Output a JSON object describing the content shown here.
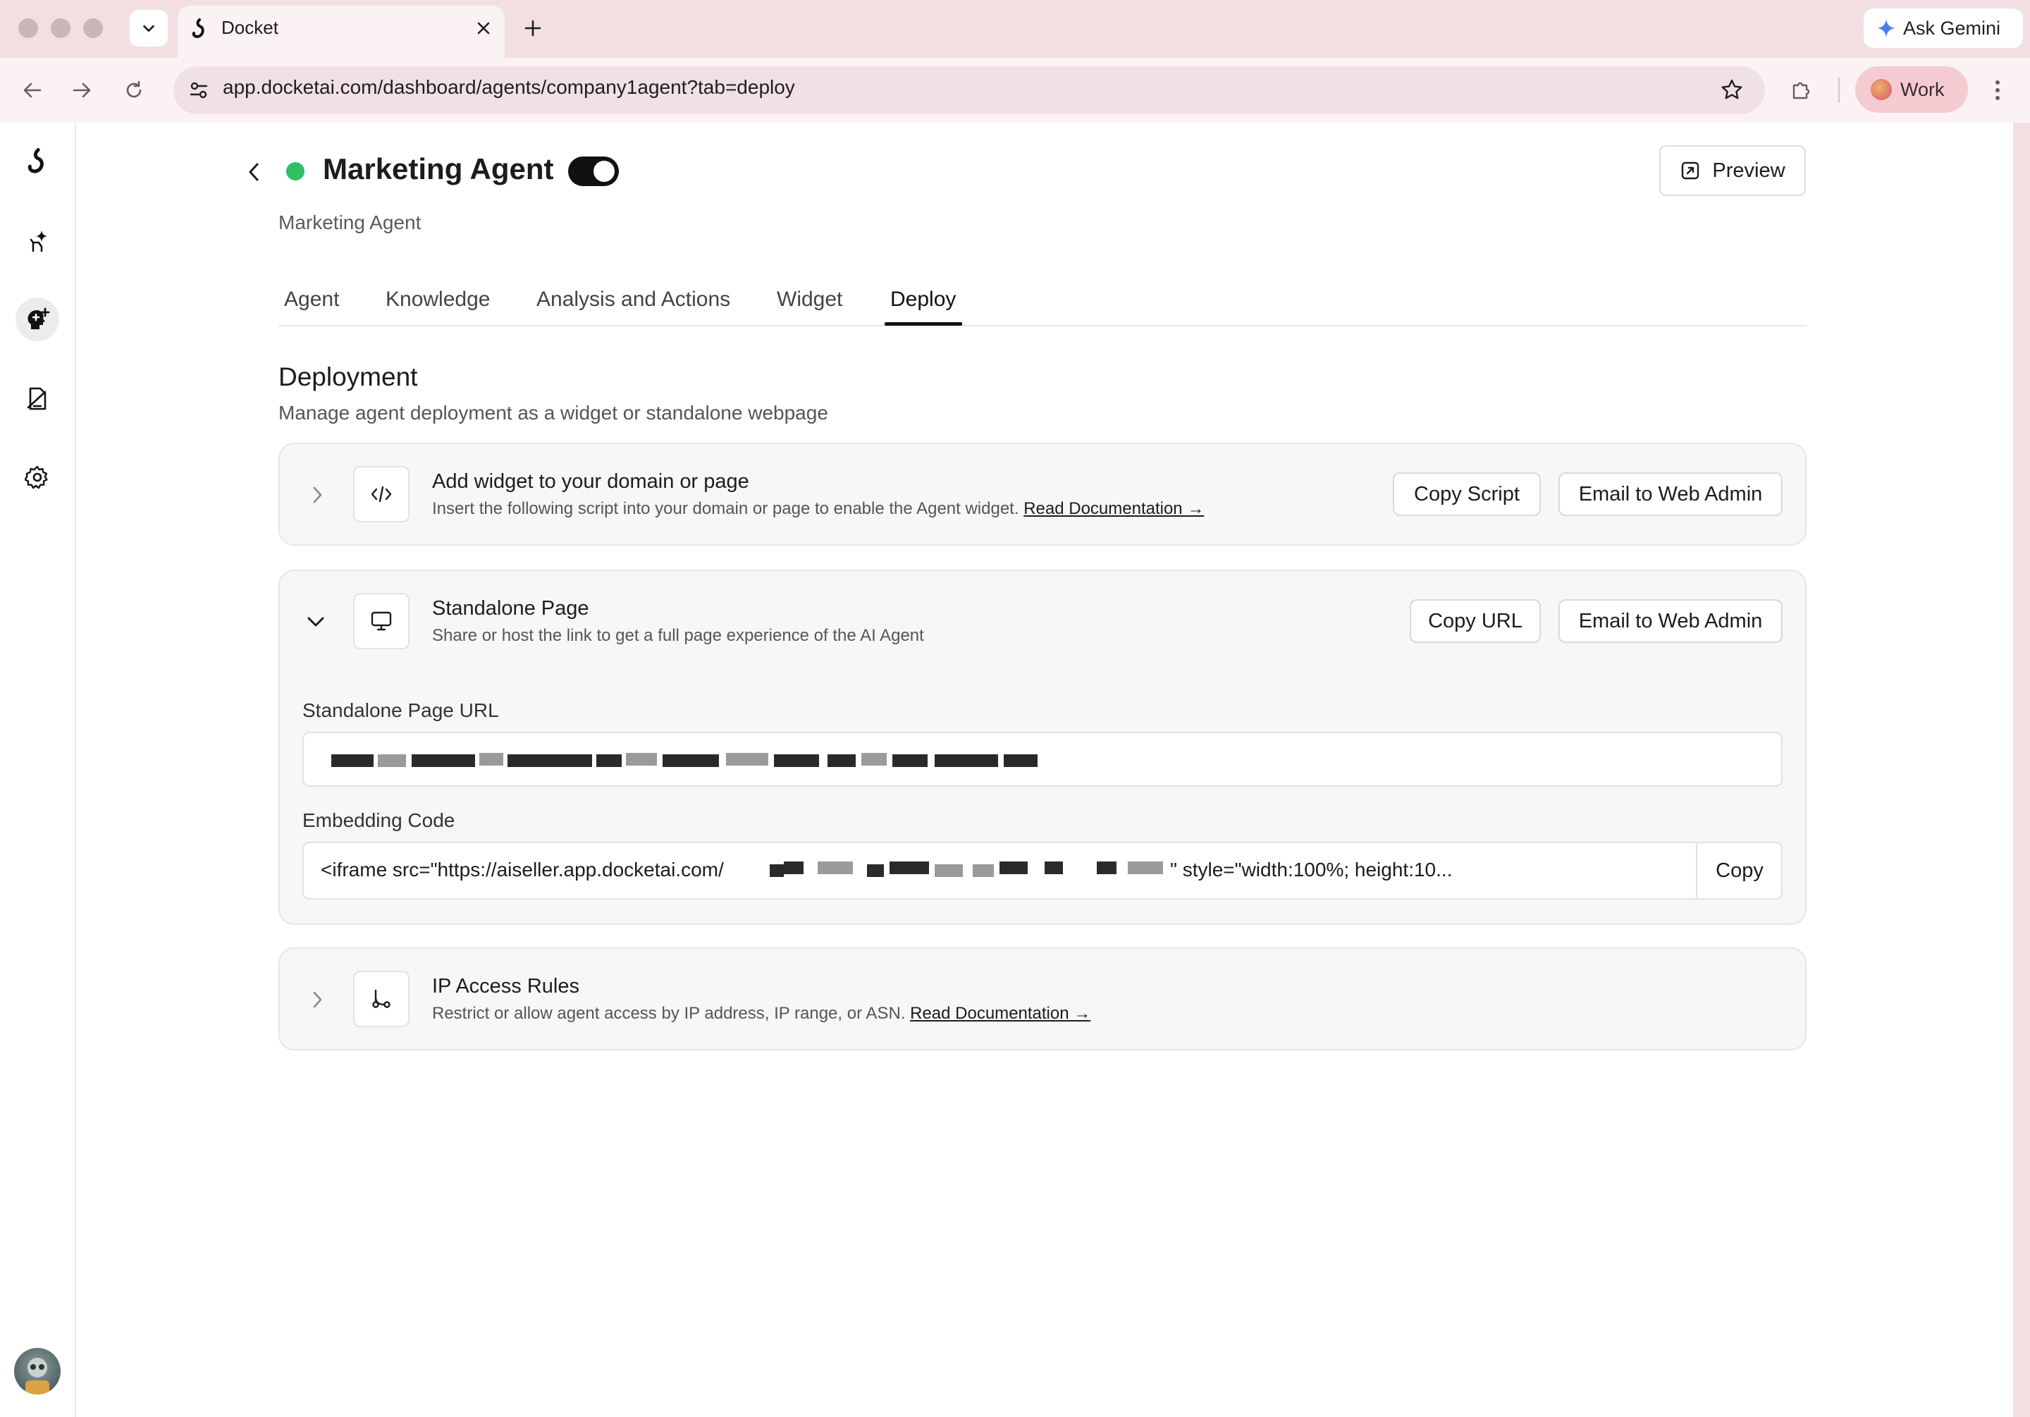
{
  "browser": {
    "tab_title": "Docket",
    "url": "app.docketai.com/dashboard/agents/company1agent?tab=deploy",
    "ask_gemini_label": "Ask Gemini",
    "profile_label": "Work"
  },
  "sidebar": {
    "items": [
      {
        "name": "logo",
        "icon": "docket-logo"
      },
      {
        "name": "agents",
        "icon": "sparkle-hand-icon"
      },
      {
        "name": "agent-builder",
        "icon": "head-plus-icon"
      },
      {
        "name": "documents",
        "icon": "document-icon"
      },
      {
        "name": "settings",
        "icon": "gear-icon"
      }
    ]
  },
  "header": {
    "title": "Marketing Agent",
    "subtitle": "Marketing Agent",
    "status": "active",
    "status_color": "#2fc064",
    "preview_label": "Preview"
  },
  "tabs": [
    {
      "label": "Agent",
      "active": false
    },
    {
      "label": "Knowledge",
      "active": false
    },
    {
      "label": "Analysis and Actions",
      "active": false
    },
    {
      "label": "Widget",
      "active": false
    },
    {
      "label": "Deploy",
      "active": true
    }
  ],
  "deployment": {
    "title": "Deployment",
    "description": "Manage agent deployment as a widget or standalone webpage",
    "widget_card": {
      "title": "Add widget to your domain or page",
      "description": "Insert the following script into your domain or page to enable the Agent widget.",
      "doc_link": "Read Documentation →",
      "copy_label": "Copy Script",
      "email_label": "Email to Web Admin"
    },
    "standalone_card": {
      "title": "Standalone Page",
      "description": "Share or host the link to get a full page experience of the AI Agent",
      "copy_label": "Copy URL",
      "email_label": "Email to Web Admin",
      "url_label": "Standalone Page URL",
      "embed_label": "Embedding Code",
      "embed_prefix": "<iframe src=\"https://aiseller.app.docketai.com/",
      "embed_suffix": "\" style=\"width:100%; height:10...",
      "embed_copy_label": "Copy"
    },
    "ip_card": {
      "title": "IP Access Rules",
      "description": "Restrict or allow agent access by IP address, IP range, or ASN.",
      "doc_link": "Read Documentation →"
    }
  }
}
